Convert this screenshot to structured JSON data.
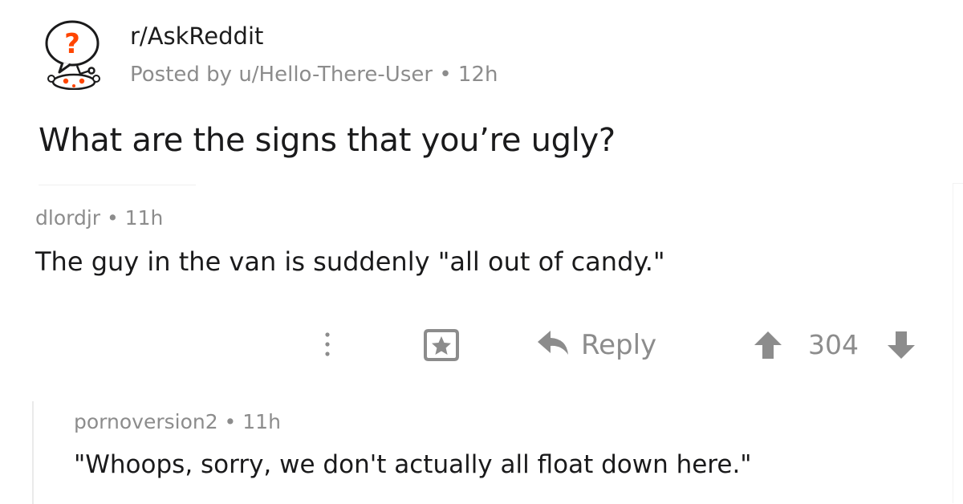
{
  "post": {
    "subreddit": "r/AskReddit",
    "meta": "Posted by u/Hello-There-User • 12h",
    "title": "What are the signs that you’re ugly?",
    "subreddit_icon": "askreddit-snoo-icon"
  },
  "comments": [
    {
      "meta": "dlordjr • 11h",
      "body": "The guy in the van is suddenly \"all out of candy.\""
    },
    {
      "meta": "pornoversion2 • 11h",
      "body": "\"Whoops, sorry, we don't actually all float down here.\""
    }
  ],
  "actions": {
    "more_icon": "more-options-icon",
    "save_icon": "award-icon",
    "reply_label": "Reply",
    "reply_icon": "reply-arrow-icon",
    "upvote_icon": "upvote-arrow-icon",
    "score": "304",
    "downvote_icon": "downvote-arrow-icon"
  },
  "colors": {
    "text": "#1a1a1b",
    "muted": "#8c8c8c",
    "accent": "#ff4500"
  }
}
